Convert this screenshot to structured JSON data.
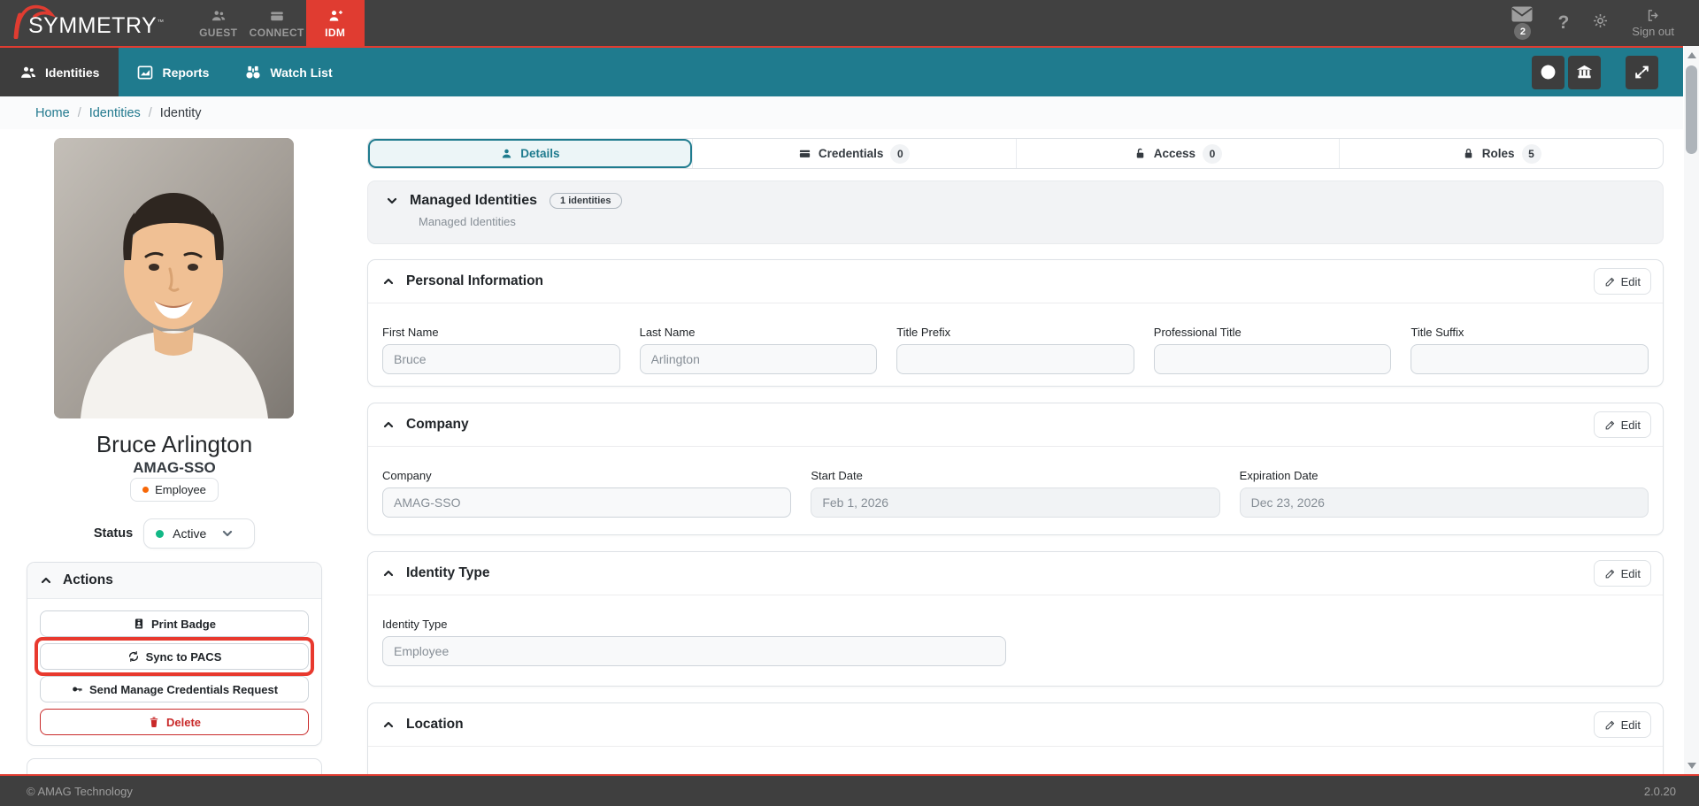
{
  "header": {
    "brand": "SYMMETRY",
    "brand_tm": "™",
    "apps": [
      {
        "label": "GUEST",
        "icon": "users-icon",
        "active": false
      },
      {
        "label": "CONNECT",
        "icon": "card-icon",
        "active": false
      },
      {
        "label": "IDM",
        "icon": "user-plus-icon",
        "active": true
      }
    ],
    "notification_count": "2",
    "sign_out_label": "Sign out"
  },
  "nav": {
    "items": [
      {
        "label": "Identities",
        "icon": "users-icon",
        "active": true
      },
      {
        "label": "Reports",
        "icon": "chart-icon",
        "active": false
      },
      {
        "label": "Watch List",
        "icon": "binoculars-icon",
        "active": false
      }
    ]
  },
  "breadcrumb": {
    "items": [
      "Home",
      "Identities",
      "Identity"
    ],
    "separator": "/"
  },
  "profile": {
    "name": "Bruce Arlington",
    "company": "AMAG-SSO",
    "type_badge": "Employee",
    "status_label": "Status",
    "status_value": "Active"
  },
  "actions": {
    "title": "Actions",
    "buttons": [
      {
        "label": "Print Badge",
        "icon": "id-badge-icon",
        "highlighted": false,
        "danger": false
      },
      {
        "label": "Sync to PACS",
        "icon": "refresh-icon",
        "highlighted": true,
        "danger": false
      },
      {
        "label": "Send Manage Credentials Request",
        "icon": "key-icon",
        "highlighted": false,
        "danger": false
      },
      {
        "label": "Delete",
        "icon": "trash-icon",
        "highlighted": false,
        "danger": true
      }
    ]
  },
  "tabs": [
    {
      "label": "Details",
      "icon": "person-icon",
      "active": true
    },
    {
      "label": "Credentials",
      "icon": "card-icon",
      "count": "0"
    },
    {
      "label": "Access",
      "icon": "unlock-icon",
      "count": "0"
    },
    {
      "label": "Roles",
      "icon": "lock-icon",
      "count": "5"
    }
  ],
  "sections": {
    "managed": {
      "title": "Managed Identities",
      "badge": "1 identities",
      "subtitle": "Managed Identities"
    },
    "personal": {
      "title": "Personal Information",
      "edit_label": "Edit",
      "fields": [
        {
          "label": "First Name",
          "value": "Bruce"
        },
        {
          "label": "Last Name",
          "value": "Arlington"
        },
        {
          "label": "Title Prefix",
          "value": ""
        },
        {
          "label": "Professional Title",
          "value": ""
        },
        {
          "label": "Title Suffix",
          "value": ""
        }
      ]
    },
    "company": {
      "title": "Company",
      "edit_label": "Edit",
      "fields": [
        {
          "label": "Company",
          "value": "AMAG-SSO"
        },
        {
          "label": "Start Date",
          "value": "Feb 1, 2026"
        },
        {
          "label": "Expiration Date",
          "value": "Dec 23, 2026"
        }
      ]
    },
    "identity_type": {
      "title": "Identity Type",
      "edit_label": "Edit",
      "fields": [
        {
          "label": "Identity Type",
          "value": "Employee"
        }
      ]
    },
    "location": {
      "title": "Location",
      "edit_label": "Edit"
    }
  },
  "footer": {
    "copyright": "© AMAG Technology",
    "version": "2.0.20"
  },
  "colors": {
    "accent_red": "#e03c31",
    "teal": "#1f7b8e",
    "header_dark": "#414141",
    "status_green": "#12b886",
    "employee_orange": "#f76707",
    "danger_red": "#c92a2a",
    "highlight_red": "#e8392e"
  }
}
